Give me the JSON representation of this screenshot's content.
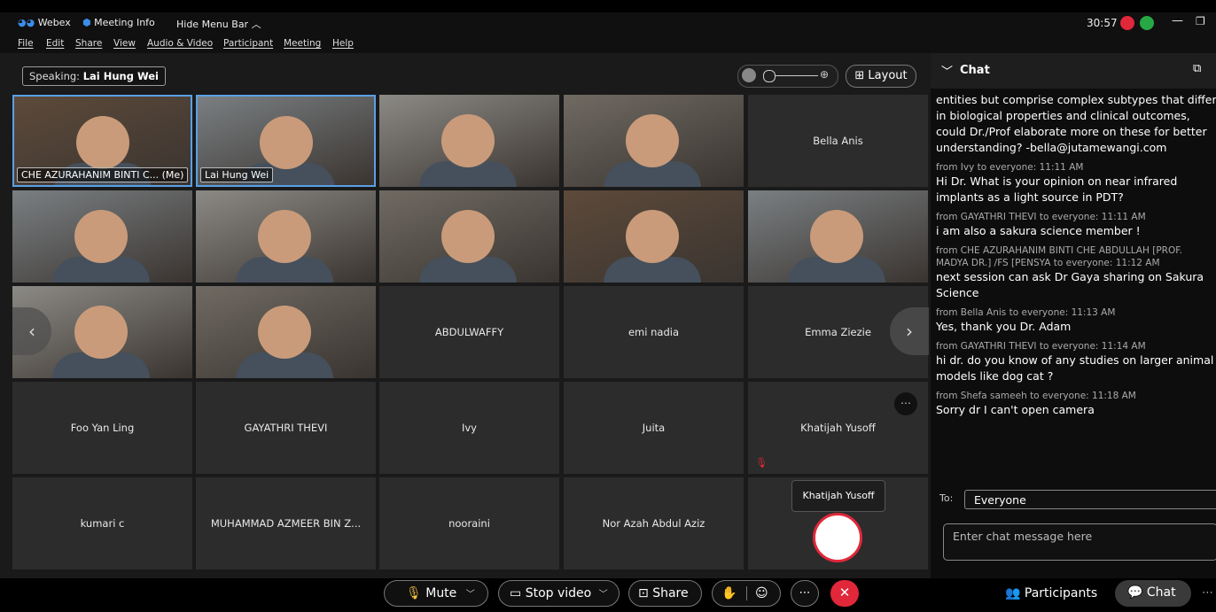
{
  "titlebar": {
    "app_name": "Webex",
    "meeting_info": "Meeting Info",
    "hide_menu": "Hide Menu Bar",
    "timer": "30:57"
  },
  "menu": {
    "items": [
      "File",
      "Edit",
      "Share",
      "View",
      "Audio & Video",
      "Participant",
      "Meeting",
      "Help"
    ]
  },
  "stage": {
    "speaking_label": "Speaking:",
    "speaking_name": "Lai Hung Wei",
    "layout_label": "Layout"
  },
  "tiles": {
    "r0": [
      {
        "name": "CHE AZURAHANIM BINTI C... (Me)",
        "video": true,
        "active": true
      },
      {
        "name": "Lai Hung Wei",
        "video": true,
        "active": true
      },
      {
        "name": "",
        "video": true
      },
      {
        "name": "",
        "video": true
      },
      {
        "name": "Bella Anis",
        "video": false
      }
    ],
    "r1": [
      {
        "name": "",
        "video": true
      },
      {
        "name": "",
        "video": true
      },
      {
        "name": "",
        "video": true
      },
      {
        "name": "",
        "video": true
      },
      {
        "name": "",
        "video": true
      }
    ],
    "r2": [
      {
        "name": "",
        "video": true
      },
      {
        "name": "",
        "video": true
      },
      {
        "name": "ABDULWAFFY",
        "video": false
      },
      {
        "name": "emi nadia",
        "video": false
      },
      {
        "name": "Emma Ziezie",
        "video": false
      }
    ],
    "r3": [
      {
        "name": "Foo Yan Ling",
        "video": false
      },
      {
        "name": "GAYATHRI THEVI",
        "video": false
      },
      {
        "name": "Ivy",
        "video": false
      },
      {
        "name": "Juita",
        "video": false
      },
      {
        "name": "Khatijah Yusoff",
        "video": false
      }
    ],
    "r4": [
      {
        "name": "kumari c",
        "video": false
      },
      {
        "name": "MUHAMMAD AZMEER BIN Z...",
        "video": false
      },
      {
        "name": "nooraini",
        "video": false
      },
      {
        "name": "Nor Azah Abdul Aziz",
        "video": false
      },
      {
        "name": "",
        "video": false
      }
    ]
  },
  "tooltip": "Khatijah Yusoff",
  "chat": {
    "title": "Chat",
    "messages": [
      {
        "meta": "",
        "text": [
          "entities but comprise complex subtypes that differ",
          "in biological properties and clinical outcomes,",
          "could Dr./Prof elaborate more on these for better",
          "understanding? -bella@jutamewangi.com"
        ]
      },
      {
        "meta": "from Ivy to everyone:   11:11 AM",
        "text": [
          "Hi Dr. What is your opinion on near infrared",
          "implants as a light source in PDT?"
        ]
      },
      {
        "meta": "from GAYATHRI THEVI to everyone:   11:11 AM",
        "text": [
          "i am also a sakura science member !"
        ]
      },
      {
        "meta": "from CHE AZURAHANIM BINTI CHE ABDULLAH [PROF. MADYA DR.] /FS [PENSYA to everyone:   11:12 AM",
        "text": [
          "next session can ask Dr Gaya sharing on Sakura",
          "Science"
        ]
      },
      {
        "meta": "from Bella Anis to everyone:   11:13 AM",
        "text": [
          "Yes, thank you Dr. Adam"
        ]
      },
      {
        "meta": "from GAYATHRI THEVI to everyone:   11:14 AM",
        "text": [
          "hi dr. do you know of any studies on larger animal",
          "models like dog cat ?"
        ]
      },
      {
        "meta": "from Shefa sameeh to everyone:   11:18 AM",
        "text": [
          "Sorry dr I can't open camera"
        ]
      }
    ],
    "to_label": "To:",
    "to_value": "Everyone",
    "input_placeholder": "Enter chat message here"
  },
  "controls": {
    "mute": "Mute",
    "stop_video": "Stop video",
    "share": "Share",
    "participants": "Participants",
    "chat": "Chat"
  },
  "colors": {
    "active_border": "#5aa0e6",
    "end_call": "#e0283a",
    "webex_blue": "#3b8eea"
  }
}
